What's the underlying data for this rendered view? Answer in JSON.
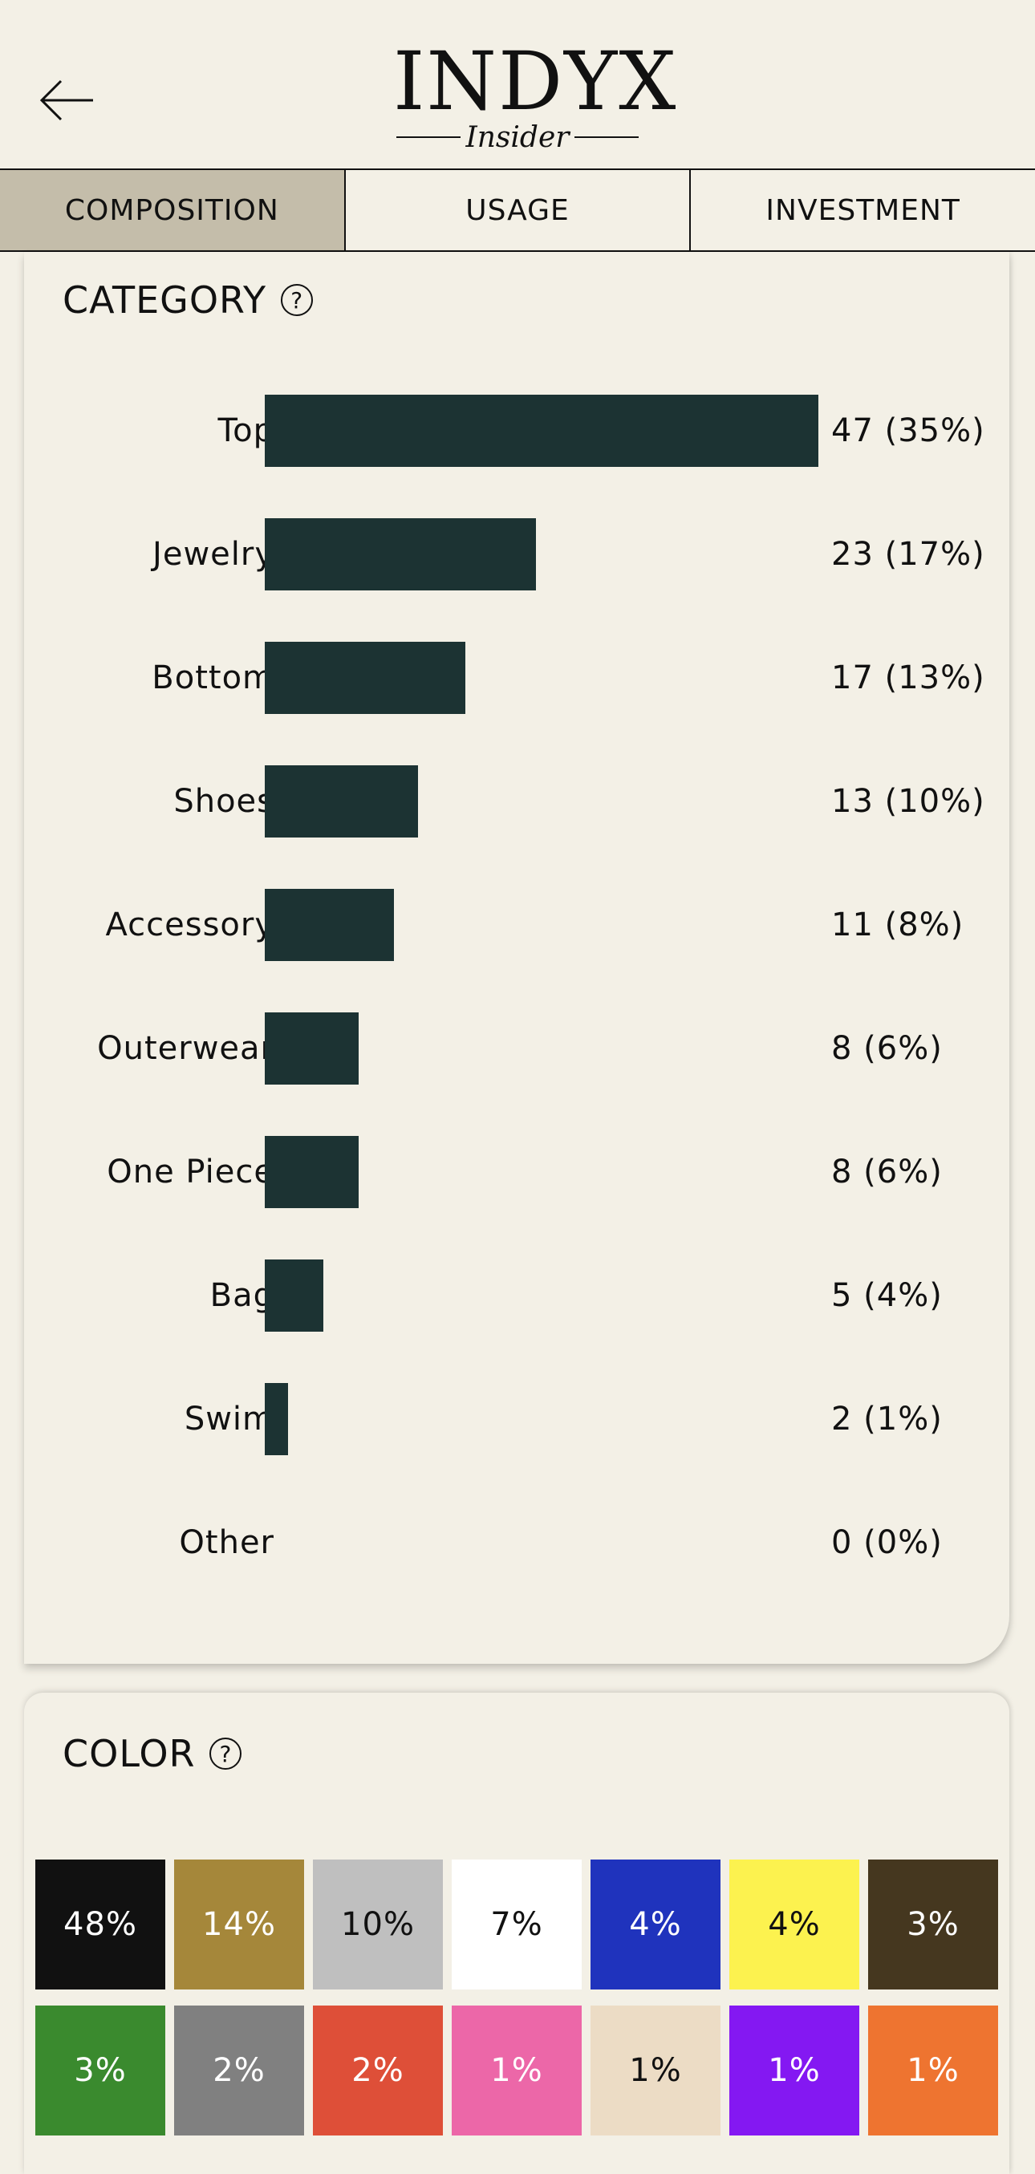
{
  "header": {
    "logo_main": "INDYX",
    "logo_sub": "Insider"
  },
  "tabs": [
    {
      "label": "COMPOSITION",
      "active": true
    },
    {
      "label": "USAGE",
      "active": false
    },
    {
      "label": "INVESTMENT",
      "active": false
    }
  ],
  "category": {
    "title": "CATEGORY",
    "help": "?"
  },
  "chart_data": {
    "type": "bar",
    "orientation": "horizontal",
    "title": "CATEGORY",
    "categories": [
      "Top",
      "Jewelry",
      "Bottom",
      "Shoes",
      "Accessory",
      "Outerwear",
      "One Piece",
      "Bag",
      "Swim",
      "Other"
    ],
    "values": [
      47,
      23,
      17,
      13,
      11,
      8,
      8,
      5,
      2,
      0
    ],
    "value_labels": [
      "47 (35%)",
      "23 (17%)",
      "17 (13%)",
      "13 (10%)",
      "11 (8%)",
      "8 (6%)",
      "8 (6%)",
      "5 (4%)",
      "2 (1%)",
      "0 (0%)"
    ],
    "bar_color": "#1c3333",
    "xlim": [
      0,
      47
    ],
    "grid": false
  },
  "color": {
    "title": "COLOR",
    "help": "?",
    "swatches": [
      {
        "label": "48%",
        "bg": "#111111",
        "fg": "#ffffff"
      },
      {
        "label": "14%",
        "bg": "#a5873a",
        "fg": "#ffffff"
      },
      {
        "label": "10%",
        "bg": "#bfbfbf",
        "fg": "#111111"
      },
      {
        "label": "7%",
        "bg": "#ffffff",
        "fg": "#111111"
      },
      {
        "label": "4%",
        "bg": "#1f33bd",
        "fg": "#ffffff"
      },
      {
        "label": "4%",
        "bg": "#fcf24f",
        "fg": "#111111"
      },
      {
        "label": "3%",
        "bg": "#45371f",
        "fg": "#ffffff"
      },
      {
        "label": "3%",
        "bg": "#3a8a2e",
        "fg": "#ffffff"
      },
      {
        "label": "2%",
        "bg": "#808080",
        "fg": "#ffffff"
      },
      {
        "label": "2%",
        "bg": "#de4f38",
        "fg": "#ffffff"
      },
      {
        "label": "1%",
        "bg": "#ec67a8",
        "fg": "#ffffff"
      },
      {
        "label": "1%",
        "bg": "#ecdcc5",
        "fg": "#111111"
      },
      {
        "label": "1%",
        "bg": "#8418f2",
        "fg": "#ffffff"
      },
      {
        "label": "1%",
        "bg": "#ee7430",
        "fg": "#ffffff"
      }
    ]
  }
}
